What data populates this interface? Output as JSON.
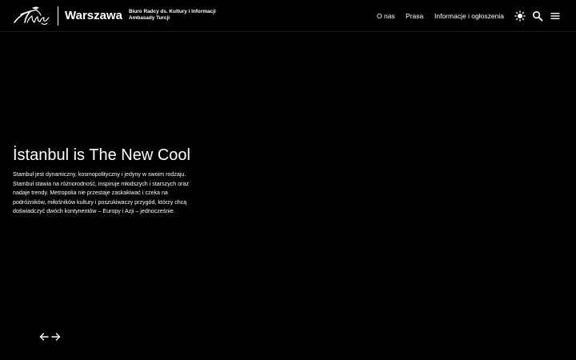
{
  "header": {
    "city": "Warszawa",
    "org_line1": "Biuro Radcy ds. Kultury i Informacji",
    "org_line2": "Ambasady Turcji",
    "logo_icon": "turkiye-logo-icon"
  },
  "nav": {
    "about": "O nas",
    "press": "Prasa",
    "info": "Informacje i ogłoszenia"
  },
  "icons": {
    "theme": "sun-icon",
    "search": "search-icon",
    "menu": "hamburger-menu-icon",
    "prev": "arrow-left-icon",
    "next": "arrow-right-icon"
  },
  "hero": {
    "title": "İstanbul is The New Cool",
    "text": "Stambuł jest dynamiczny, kosmopolityczny i jedyny w swoim rodzaju. Stambuł stawia na różnorodność, inspiruje młodszych i starszych oraz nadaje trendy. Metropolia nie przestaje zaskakiwać i czeka na podróżników, miłośników kultury i poszukiwaczy przygód, którzy chcą doświadczyć dwóch kontynentów – Europy i Azji – jednocześnie."
  },
  "colors": {
    "background": "#000000",
    "text": "#ffffff"
  }
}
